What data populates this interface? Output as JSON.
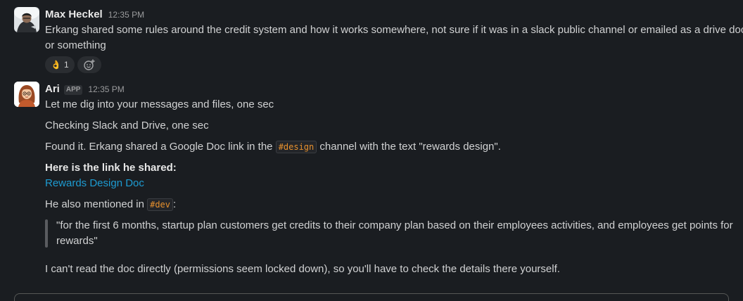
{
  "messages": {
    "max": {
      "name": "Max Heckel",
      "time": "12:35 PM",
      "text_line1": "Erkang shared some rules around the credit system and how it works somewhere, not sure if it was in a slack public channel or emailed as a drive doc",
      "text_line2": "or something",
      "reaction": {
        "emoji": "👌",
        "count": "1"
      },
      "avatar_icon": "profile-photo"
    },
    "ari": {
      "name": "Ari",
      "badge": "APP",
      "time": "12:35 PM",
      "avatar_icon": "cartoon-woman-avatar",
      "line1": "Let me dig into your messages and files, one sec",
      "line2": "Checking Slack and Drive, one sec",
      "line3_before": "Found it. Erkang shared a Google Doc link in the ",
      "line3_channel": "#design",
      "line3_after": " channel with the text \"rewards design\".",
      "link_heading": "Here is the link he shared:",
      "link_text": "Rewards Design Doc",
      "mention_before": "He also mentioned in ",
      "mention_channel": "#dev",
      "mention_after": ":",
      "quote": "\"for the first 6 months, startup plan customers get credits to their company plan based on their employees activities, and employees get points for rewards\"",
      "closing": "I can't read the doc directly (permissions seem locked down), so you'll have to check the details there yourself."
    }
  },
  "colors": {
    "background": "#1a1d21",
    "link": "#1d9bd1",
    "channel_code": "#e8912d"
  }
}
